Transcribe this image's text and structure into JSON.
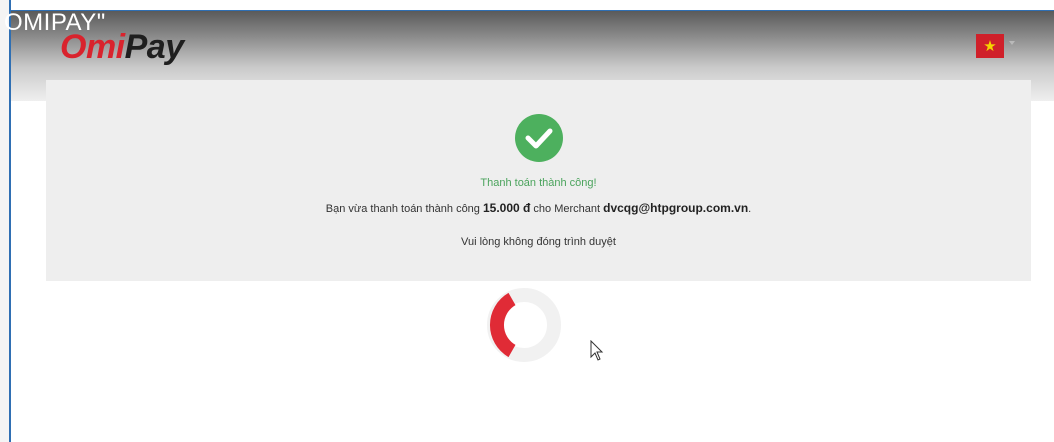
{
  "overlay": {
    "title": "OMIPAY\""
  },
  "header": {
    "logo_part1": "Omi",
    "logo_part2": "Pay",
    "language_flag": "vietnam-flag",
    "flag_star": "★"
  },
  "status": {
    "success_title": "Thanh toán thành công!",
    "detail_prefix": "Bạn vừa thanh toán thành công ",
    "amount": "15.000 đ",
    "detail_middle": " cho Merchant ",
    "merchant": "dvcqg@htpgroup.com.vn",
    "detail_suffix": ".",
    "close_browser_msg": "Vui lòng không đóng trình duyệt"
  },
  "colors": {
    "brand_red": "#d9232d",
    "success_green": "#4db05e",
    "spinner_red": "#e02b36"
  }
}
